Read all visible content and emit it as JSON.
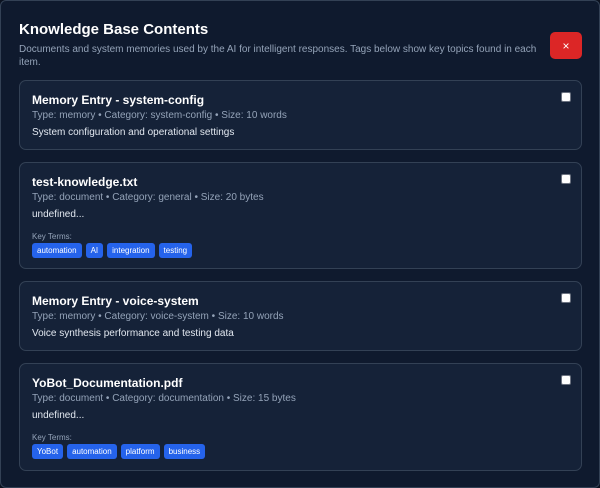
{
  "header": {
    "title": "Knowledge Base Contents",
    "subtitle": "Documents and system memories used by the AI for intelligent responses. Tags below show key topics found in each item.",
    "close_label": "×"
  },
  "key_terms_label": "Key Terms:",
  "items": [
    {
      "title": "Memory Entry - system-config",
      "meta": "Type: memory • Category: system-config • Size: 10 words",
      "description": "System configuration and operational settings",
      "tags": []
    },
    {
      "title": "test-knowledge.txt",
      "meta": "Type: document • Category: general • Size: 20 bytes",
      "description": "undefined...",
      "tags": [
        "automation",
        "AI",
        "integration",
        "testing"
      ]
    },
    {
      "title": "Memory Entry - voice-system",
      "meta": "Type: memory • Category: voice-system • Size: 10 words",
      "description": "Voice synthesis performance and testing data",
      "tags": []
    },
    {
      "title": "YoBot_Documentation.pdf",
      "meta": "Type: document • Category: documentation • Size: 15 bytes",
      "description": "undefined...",
      "tags": [
        "YoBot",
        "automation",
        "platform",
        "business"
      ]
    }
  ]
}
